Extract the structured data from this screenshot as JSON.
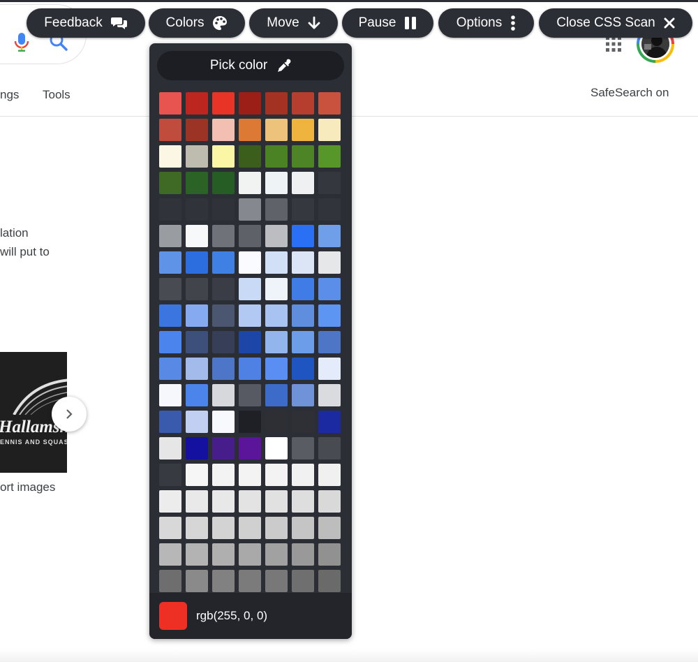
{
  "page": {
    "nav_settings": "ngs",
    "nav_tools": "Tools",
    "safesearch": "SafeSearch on",
    "snippet_line1": "lation",
    "snippet_line2": "will put to",
    "thumb_title": "Hallamsh",
    "thumb_subtitle": "ENNIS AND SQUASH",
    "caption": "ort images"
  },
  "toolbar": {
    "feedback": "Feedback",
    "colors": "Colors",
    "move": "Move",
    "pause": "Pause",
    "options": "Options",
    "close": "Close CSS Scan"
  },
  "color_panel": {
    "pick_label": "Pick color",
    "current_color": "#ee3024",
    "current_value": "rgb(255, 0, 0)",
    "swatches": [
      "#e8544f",
      "#bc261e",
      "#e83426",
      "#9b1f17",
      "#a43223",
      "#b53e2e",
      "#c9523f",
      "#bf4c3c",
      "#9c3426",
      "#f4bfb3",
      "#dc7935",
      "#edc27b",
      "#eeb43e",
      "#f7ebbd",
      "#fcf7e4",
      "#bdbcae",
      "#fbf6a6",
      "#3c5e1d",
      "#4b8324",
      "#4d8526",
      "#579628",
      "#3f6a25",
      "#2b6327",
      "#265d24",
      "#f1f3f3",
      "#eef3f5",
      "#eff0f1",
      "#34373d",
      "#30333a",
      "#30333a",
      "#2f3238",
      "#85898f",
      "#5f6369",
      "#35383f",
      "#31343a",
      "#999ca0",
      "#f6f8f9",
      "#6f7278",
      "#5e6168",
      "#bbbdc0",
      "#2a70f5",
      "#6e9fe8",
      "#5e93e7",
      "#2c6de0",
      "#3e80e3",
      "#f9fbff",
      "#d1e0f7",
      "#dbe5f6",
      "#e6e7e9",
      "#494b53",
      "#42444b",
      "#3a3d46",
      "#c9daf6",
      "#eff3fa",
      "#3f7ce6",
      "#5a8ee8",
      "#3b76e0",
      "#86aaf0",
      "#4b5671",
      "#b2c9f3",
      "#a8c2f1",
      "#5f8ede",
      "#5d96f2",
      "#4b84ec",
      "#3d4f7b",
      "#373f58",
      "#1c47a8",
      "#93b5ee",
      "#6b9de9",
      "#4d76c6",
      "#5889e4",
      "#a2bbea",
      "#4d76c9",
      "#4f80e3",
      "#5a8ef3",
      "#1e55c0",
      "#e4ecfb",
      "#f5f7fd",
      "#4b84ea",
      "#d6d8db",
      "#575a63",
      "#3d6bc9",
      "#7092d8",
      "#d9dbde",
      "#3a5aad",
      "#c0cff2",
      "#f7f9fd",
      "#1e2025",
      "#2d2f35",
      "#2e3035",
      "#1c2aa2",
      "#e6e6e7",
      "#1411a0",
      "#471d8b",
      "#5b159b",
      "#ffffff",
      "#5a5c63",
      "#494b52",
      "#373a41",
      "#f6f6f6",
      "#f3f3f3",
      "#f3f3f3",
      "#f3f3f3",
      "#f1f1f1",
      "#f0f0f0",
      "#ececec",
      "#e9e9e9",
      "#e8e8e8",
      "#e3e3e3",
      "#e1e1e1",
      "#dedede",
      "#d9d9d9",
      "#d8d8d8",
      "#d6d6d6",
      "#d3d3d3",
      "#d0d0d0",
      "#cbcbcb",
      "#c5c5c5",
      "#bdbdbd",
      "#b7b7b7",
      "#b3b3b3",
      "#afafaf",
      "#a9a9a9",
      "#a1a1a1",
      "#999999",
      "#919191",
      "#6e6e6e",
      "#8a8a8a",
      "#818181",
      "#7b7b7b",
      "#787878",
      "#6f6f6f",
      "#6a6a6a"
    ]
  },
  "icons": {
    "feedback": "chat-bubbles-icon",
    "colors": "palette-icon",
    "move": "arrow-down-icon",
    "pause": "pause-icon",
    "options": "vertical-dots-icon",
    "close": "close-x-icon",
    "pick": "eyedropper-icon"
  }
}
